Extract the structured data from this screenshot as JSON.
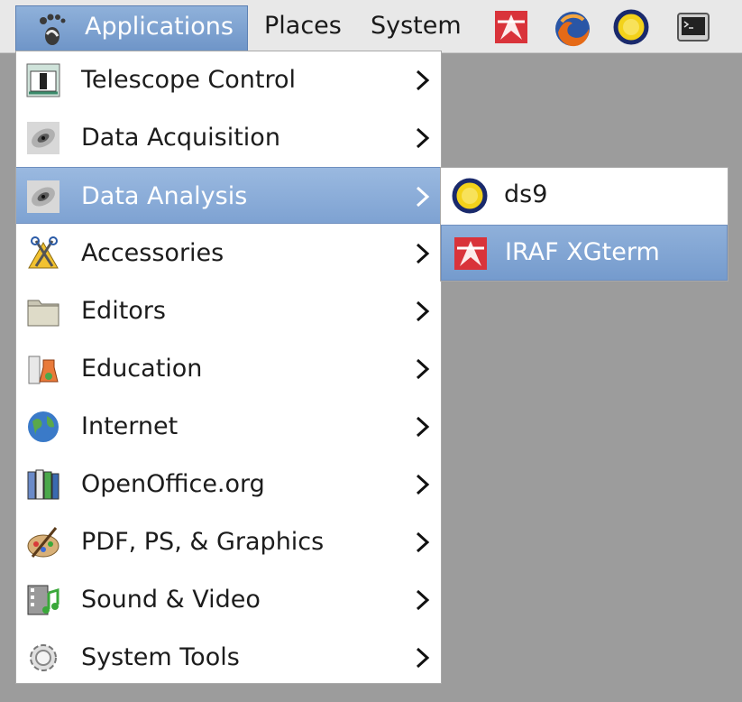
{
  "panel": {
    "menus": [
      {
        "label": "Applications",
        "icon": "gnome-foot-icon"
      },
      {
        "label": "Places"
      },
      {
        "label": "System"
      }
    ],
    "launchers": [
      "iraf-icon",
      "firefox-icon",
      "ds9-icon",
      "terminal-icon"
    ]
  },
  "applications_menu": {
    "items": [
      {
        "label": "Telescope Control",
        "icon": "telescope-icon"
      },
      {
        "label": "Data Acquisition",
        "icon": "galaxy-icon"
      },
      {
        "label": "Data Analysis",
        "icon": "galaxy-icon",
        "highlighted": true
      },
      {
        "label": "Accessories",
        "icon": "accessories-icon"
      },
      {
        "label": "Editors",
        "icon": "folder-icon"
      },
      {
        "label": "Education",
        "icon": "education-icon"
      },
      {
        "label": "Internet",
        "icon": "globe-icon"
      },
      {
        "label": "OpenOffice.org",
        "icon": "office-icon"
      },
      {
        "label": "PDF, PS, & Graphics",
        "icon": "graphics-icon"
      },
      {
        "label": "Sound & Video",
        "icon": "media-icon"
      },
      {
        "label": "System Tools",
        "icon": "gear-icon"
      }
    ]
  },
  "data_analysis_submenu": {
    "items": [
      {
        "label": "ds9",
        "icon": "ds9-icon"
      },
      {
        "label": "IRAF XGterm",
        "icon": "iraf-icon",
        "highlighted": true
      }
    ]
  },
  "colors": {
    "highlight": "#7ea2d2",
    "desktop": "#9c9c9c",
    "panel": "#e8e8e8"
  }
}
